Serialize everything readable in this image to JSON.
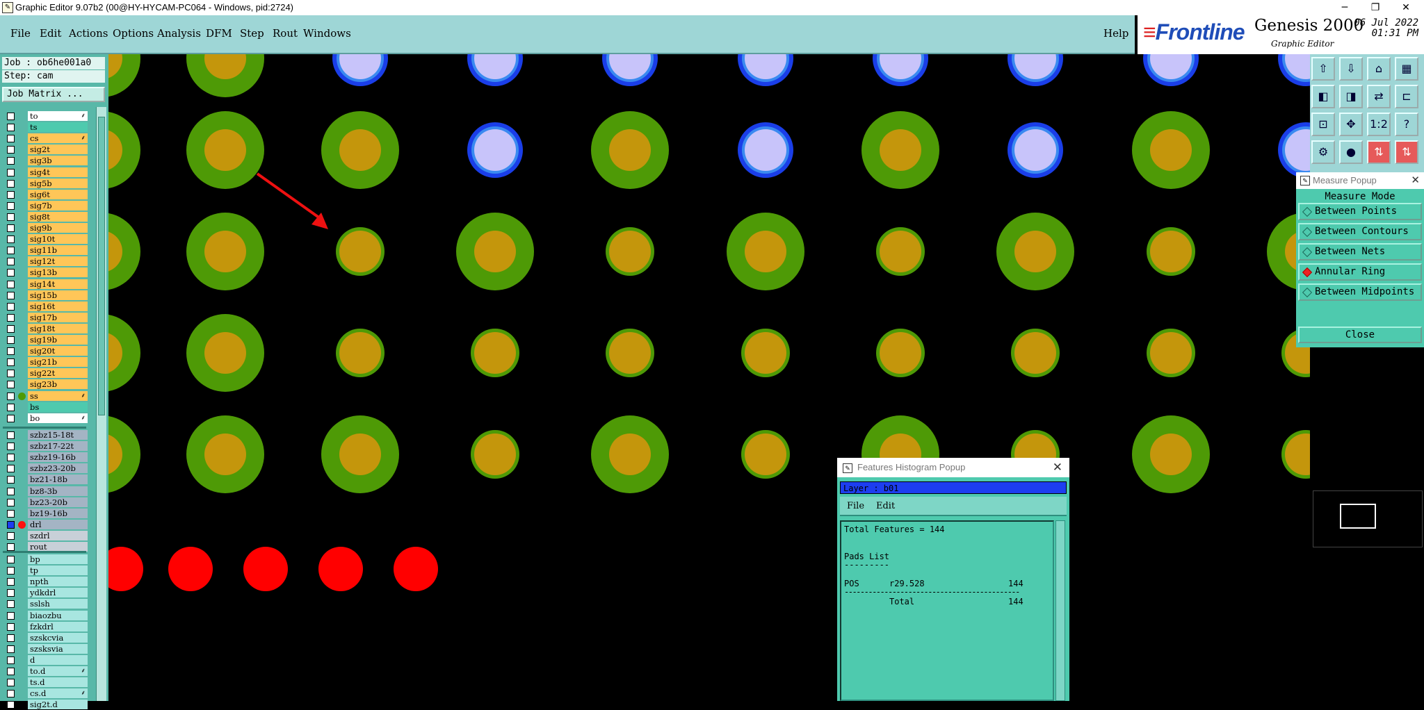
{
  "window": {
    "title": "Graphic Editor 9.07b2 (00@HY-HYCAM-PC064 - Windows, pid:2724)"
  },
  "menu": {
    "items": [
      "File",
      "Edit",
      "Actions",
      "Options",
      "Analysis",
      "DFM",
      "Step",
      "Rout",
      "Windows"
    ],
    "help": "Help"
  },
  "brand": {
    "logo": "Frontline",
    "product": "Genesis 2000",
    "subtitle": "Graphic Editor",
    "date": "06 Jul 2022",
    "time": "01:31 PM"
  },
  "job": {
    "job_label": "Job : ob6he001a0",
    "step_label": "Step: cam",
    "matrix_button": "Job Matrix ..."
  },
  "layers": {
    "group1": [
      "to",
      "ts",
      "cs",
      "sig2t",
      "sig3b",
      "sig4t",
      "sig5b",
      "sig6t",
      "sig7b",
      "sig8t",
      "sig9b",
      "sig10t",
      "sig11b",
      "sig12t",
      "sig13b",
      "sig14t",
      "sig15b",
      "sig16t",
      "sig17b",
      "sig18t",
      "sig19b",
      "sig20t",
      "sig21b",
      "sig22t",
      "sig23b",
      "ss",
      "bs",
      "bo"
    ],
    "group2": [
      "szbz15-18t",
      "szbz17-22t",
      "szbz19-16b",
      "szbz23-20b",
      "bz21-18b",
      "bz8-3b",
      "bz23-20b",
      "bz19-16b",
      "drl",
      "szdrl",
      "rout"
    ],
    "group3": [
      "bp",
      "tp",
      "npth",
      "ydkdrl",
      "sslsh",
      "biaozbu",
      "fzkdrl",
      "szskcvia",
      "szsksvia",
      "d",
      "to.d",
      "ts.d",
      "cs.d",
      "sig2t.d"
    ]
  },
  "measure": {
    "title": "Measure Popup",
    "mode_label": "Measure Mode",
    "options": [
      "Between Points",
      "Between Contours",
      "Between Nets",
      "Annular Ring",
      "Between Midpoints"
    ],
    "selected": "Annular Ring",
    "close": "Close"
  },
  "histogram": {
    "title": "Features Histogram Popup",
    "layer_label": "Layer :  b01",
    "menu": [
      "File",
      "Edit"
    ],
    "total_line": "Total Features = 144",
    "pads_header": "Pads List",
    "pads_underline": "---------",
    "row_type": "POS",
    "row_symbol": "r29.528",
    "row_count": "144",
    "divider": "--------------------------------------------",
    "total_label": "Total",
    "total_count": "144"
  },
  "colors": {
    "ring_green": "#4e9a06",
    "pad_gold": "#c4960c",
    "via_blue": "#1a3ee8",
    "via_light": "#c8c4fa",
    "red_pad": "#ff0000",
    "panel_teal": "#9ed6d6"
  },
  "icons": [
    "app-icon",
    "minimize-icon",
    "restore-icon",
    "close-icon"
  ]
}
